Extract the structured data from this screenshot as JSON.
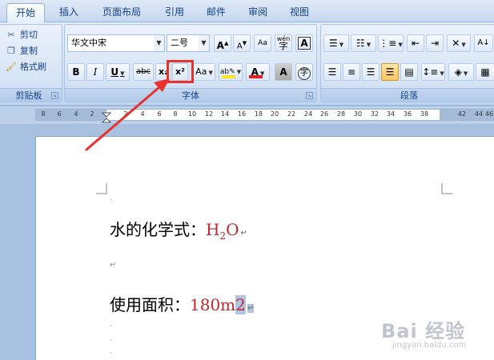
{
  "tabs": [
    "开始",
    "插入",
    "页面布局",
    "引用",
    "邮件",
    "审阅",
    "视图"
  ],
  "clipboard": {
    "cut": "剪切",
    "copy": "复制",
    "format_painter": "格式刷",
    "group_label": "剪贴板"
  },
  "font": {
    "name": "华文中宋",
    "size": "二号",
    "group_label": "字体",
    "grow_label": "A",
    "shrink_label": "A",
    "clear_label": "Aa",
    "pinyin_label": "wén",
    "border_label": "A",
    "bold": "B",
    "italic": "I",
    "underline": "U",
    "strike": "abc",
    "subscript": "x₂",
    "superscript": "x²",
    "case": "Aa",
    "highlight": "ab",
    "font_color": "A",
    "shade": "A",
    "enclose": "字",
    "highlight_color": "#f6e827",
    "font_color_bar": "#e02020"
  },
  "paragraph": {
    "group_label": "段落"
  },
  "ruler_labels": [
    "8",
    "6",
    "4",
    "2",
    "2",
    "4",
    "6",
    "8",
    "10",
    "12",
    "14",
    "16",
    "18",
    "20",
    "22",
    "24",
    "26",
    "28",
    "30",
    "32",
    "34",
    "36",
    "38",
    "42",
    "44",
    "46"
  ],
  "document": {
    "line1_label": "水的化学式：",
    "line1_h": "H",
    "line1_sub": "2",
    "line1_o": "O",
    "line2_label": "使用面积：",
    "line2_value": "180m",
    "line2_selected": "2",
    "para_mark": "↵",
    "small_mark": "·"
  },
  "watermark": {
    "main": "Bai 经验",
    "sub": "jingyan.baidu.com"
  }
}
